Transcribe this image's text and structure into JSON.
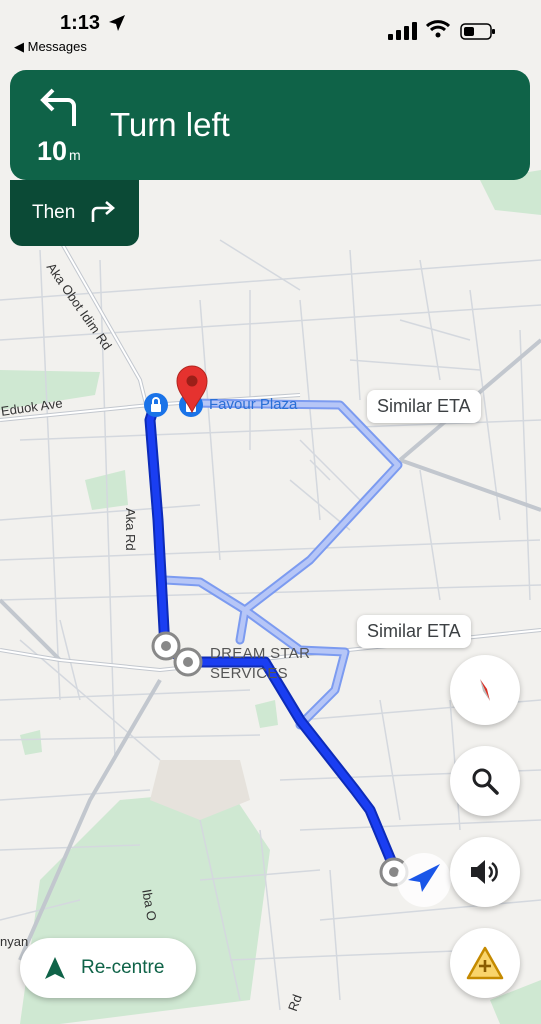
{
  "status_bar": {
    "time": "1:13",
    "back_label": "◀ Messages"
  },
  "navigation": {
    "distance_value": "10",
    "distance_unit": "m",
    "instruction": "Turn left",
    "then_label": "Then",
    "maneuver_icon": "turn-left-arrow-icon",
    "next_maneuver_icon": "turn-right-arrow-icon"
  },
  "map": {
    "eta_chips": [
      "Similar ETA",
      "Similar ETA"
    ],
    "places": {
      "destination": "Favour Plaza",
      "business_line1": "DREAM STAR",
      "business_line2": "SERVICES"
    },
    "roads": {
      "eduok": "Eduok Ave",
      "aka_obot": "Aka Obot Idim Rd",
      "aka": "Aka Rd",
      "iba": "Iba O",
      "rd_bottom": "Rd",
      "nyan": "nyan"
    },
    "route_color": "#1a3ef2",
    "alt_route_color": "#a9bdf5",
    "banner_color": "#0f6348"
  },
  "controls": {
    "compass_icon": "compass-icon",
    "search_icon": "search-icon",
    "sound_icon": "speaker-icon",
    "report_icon": "add-report-icon",
    "recentre_label": "Re-centre"
  }
}
